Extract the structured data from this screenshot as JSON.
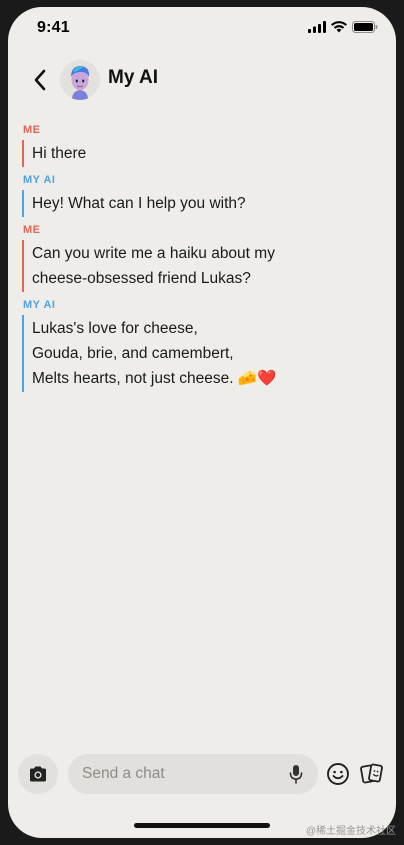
{
  "status_bar": {
    "time": "9:41",
    "icons": [
      "signal-icon",
      "wifi-icon",
      "battery-icon"
    ]
  },
  "header": {
    "back_icon": "chevron-left-icon",
    "avatar_icon": "bitmoji-avatar",
    "title": "My AI"
  },
  "messages": [
    {
      "sender": "ME",
      "role": "me",
      "lines": [
        "Hi there"
      ]
    },
    {
      "sender": "MY AI",
      "role": "ai",
      "lines": [
        "Hey! What can I help you with?"
      ]
    },
    {
      "sender": "ME",
      "role": "me",
      "lines": [
        "Can you write me a haiku about my",
        "cheese-obsessed friend Lukas?"
      ]
    },
    {
      "sender": "MY AI",
      "role": "ai",
      "lines": [
        "Lukas's love for cheese,",
        "Gouda, brie, and camembert,",
        "Melts hearts, not just cheese. 🧀❤️"
      ]
    }
  ],
  "composer": {
    "camera_icon": "camera-icon",
    "placeholder": "Send a chat",
    "value": "",
    "mic_icon": "microphone-icon",
    "emoji_icon": "smiley-icon",
    "sticker_icon": "sticker-cards-icon"
  },
  "colors": {
    "background": "#efedea",
    "me_accent": "#e1665a",
    "ai_accent": "#4fa3e3",
    "input_bg": "#e2e0dc"
  },
  "watermark": "@稀土掘金技术社区"
}
